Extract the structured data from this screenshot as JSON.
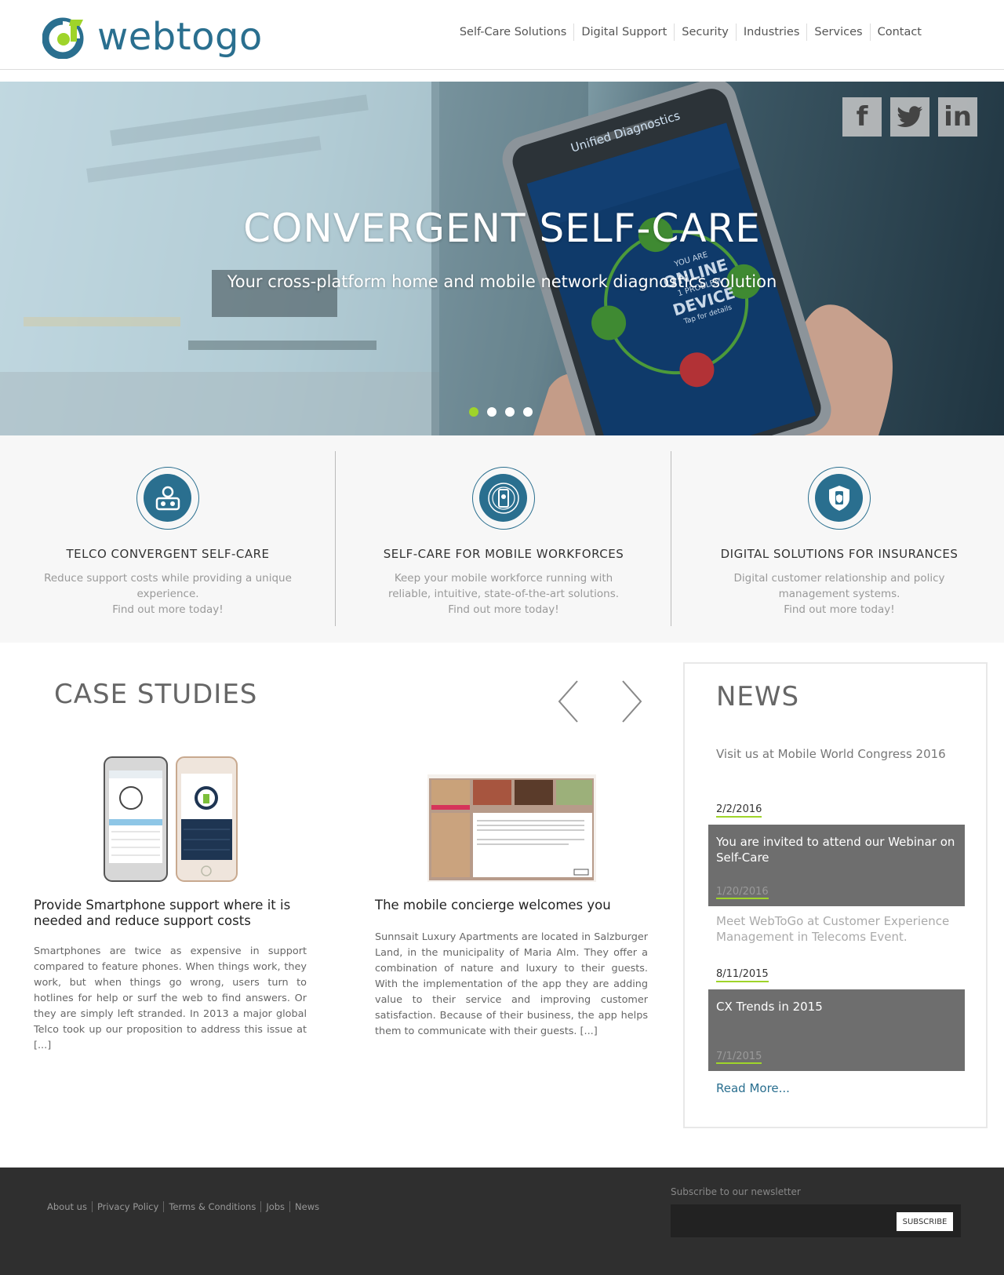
{
  "header": {
    "logo_text": "webtogo",
    "nav": [
      "Self-Care Solutions",
      "Digital Support",
      "Security",
      "Industries",
      "Services",
      "Contact"
    ]
  },
  "hero": {
    "title": "CONVERGENT SELF-CARE",
    "subtitle": "Your cross-platform home and mobile network diagnostics solution",
    "phone_screen_title": "Unified Diagnostics",
    "phone_status_lines": [
      "YOU ARE",
      "ONLINE",
      "1 PROBLEM",
      "DEVICE",
      "Tap for details"
    ],
    "social": [
      "f",
      "twitter",
      "in"
    ],
    "slides_total": 4,
    "active_slide": 1
  },
  "features": [
    {
      "title": "TELCO CONVERGENT SELF-CARE",
      "text": "Reduce support costs while providing a unique experience.",
      "cta": "Find out more today!",
      "icon": "support-agent-icon"
    },
    {
      "title": "SELF-CARE FOR MOBILE WORKFORCES",
      "text": "Keep your mobile workforce running with reliable, intuitive, state-of-the-art solutions.",
      "cta": "Find out more today!",
      "icon": "mobile-network-icon"
    },
    {
      "title": "DIGITAL SOLUTIONS FOR INSURANCES",
      "text": "Digital customer relationship and policy management systems.",
      "cta": "Find out more today!",
      "icon": "shield-phone-icon"
    }
  ],
  "case_studies": {
    "title": "CASE STUDIES",
    "items": [
      {
        "heading": "Provide Smartphone support where it is needed and reduce support costs",
        "text": "Smartphones are twice as expensive in support compared to feature phones. When things work, they work, but when things go wrong, users turn to hotlines for help or surf the web to find answers. Or they are simply left stranded. In 2013 a major global Telco took up our proposition to address this issue at [...]"
      },
      {
        "heading": "The mobile concierge welcomes you",
        "text": "Sunnsait Luxury Apartments are located in Salzburger Land, in the municipality of Maria Alm. They offer a combination of nature and luxury to their guests. With the implementation of the app they are adding value to their service and improving customer satisfaction. Because of their business, the app helps them to communicate with their guests. [...]"
      }
    ]
  },
  "news": {
    "title": "NEWS",
    "lead": "Visit us at Mobile World Congress 2016",
    "items": [
      {
        "date": "2/2/2016",
        "card_title": "You are invited to attend our Webinar on Self-Care",
        "card_date": "1/20/2016",
        "after_text": "Meet WebToGo at Customer Experience Management in Telecoms Event."
      },
      {
        "date": "8/11/2015",
        "card_title": "CX Trends in 2015",
        "card_date": "7/1/2015"
      }
    ],
    "read_more": "Read More..."
  },
  "footer": {
    "links": [
      "About us",
      "Privacy Policy",
      "Terms & Conditions",
      "Jobs",
      "News"
    ],
    "subscribe_label": "Subscribe to our newsletter",
    "subscribe_button": "SUBSCRIBE"
  },
  "colors": {
    "brand": "#2a6f8f",
    "accent": "#9fd42a",
    "footer": "#2f2f2f"
  }
}
